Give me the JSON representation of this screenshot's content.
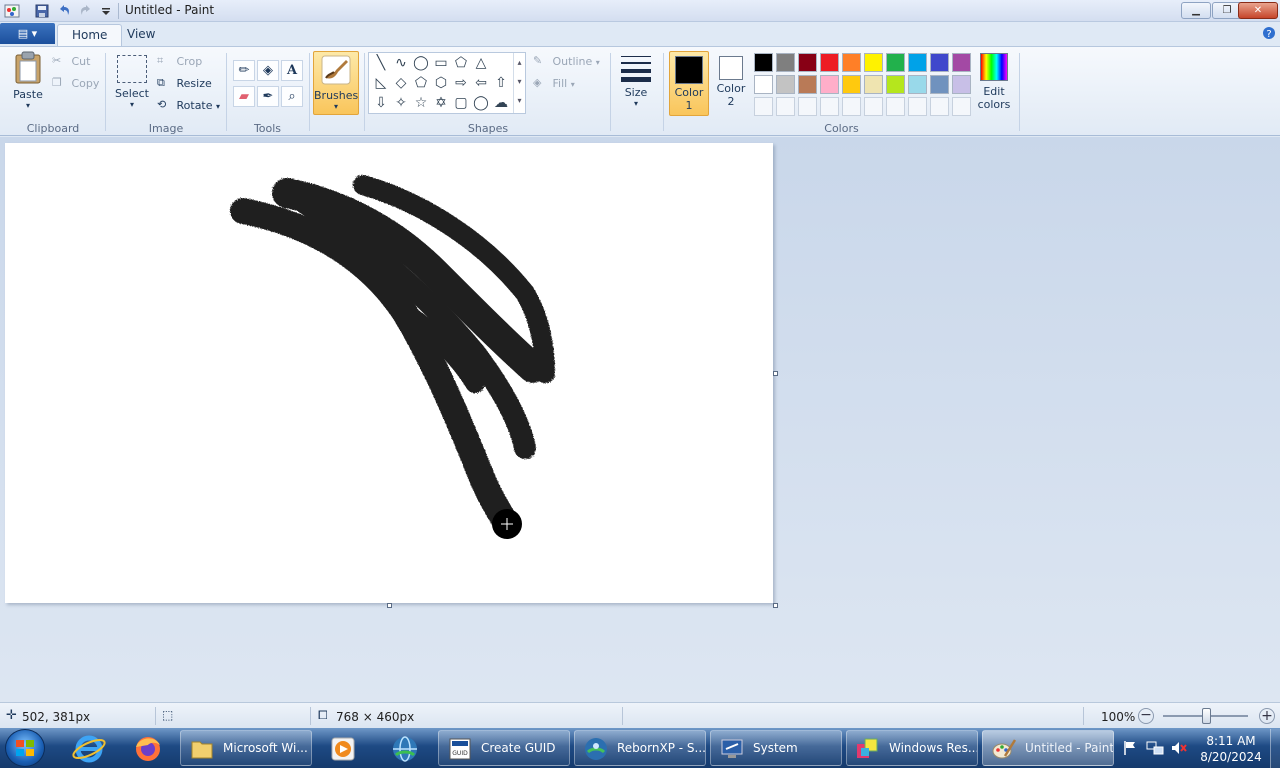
{
  "window": {
    "title": "Untitled - Paint",
    "minimize_label": "▁",
    "maximize_label": "❐",
    "close_label": "✕"
  },
  "ribbon": {
    "file_label": "▤ ▾",
    "tabs": [
      {
        "label": "Home"
      },
      {
        "label": "View"
      }
    ],
    "clipboard": {
      "paste": "Paste",
      "cut": "Cut",
      "copy": "Copy",
      "group": "Clipboard"
    },
    "image": {
      "select": "Select",
      "crop": "Crop",
      "resize": "Resize",
      "rotate": "Rotate",
      "group": "Image"
    },
    "tools": {
      "group": "Tools"
    },
    "brushes": {
      "label": "Brushes"
    },
    "shapes": {
      "outline": "Outline",
      "fill": "Fill",
      "group": "Shapes"
    },
    "size": {
      "label": "Size"
    },
    "colors": {
      "color1_line1": "Color",
      "color1_line2": "1",
      "color2_line1": "Color",
      "color2_line2": "2",
      "edit_line1": "Edit",
      "edit_line2": "colors",
      "group": "Colors",
      "color1_value": "#000000",
      "color2_value": "#ffffff",
      "palette_row1": [
        "#000000",
        "#7f7f7f",
        "#880015",
        "#ed1c24",
        "#ff7f27",
        "#fff200",
        "#22b14c",
        "#00a2e8",
        "#3f48cc",
        "#a349a4"
      ],
      "palette_row2": [
        "#ffffff",
        "#c3c3c3",
        "#b97a57",
        "#ffaec9",
        "#ffc90e",
        "#efe4b0",
        "#b5e61d",
        "#99d9ea",
        "#7092be",
        "#c8bfe7"
      ]
    }
  },
  "status": {
    "cursor_pos": "502, 381px",
    "canvas_size": "768 × 460px",
    "zoom": "100%"
  },
  "taskbar": {
    "buttons": [
      {
        "label": "Microsoft Wi..."
      },
      {
        "label": "Create GUID"
      },
      {
        "label": "RebornXP - S..."
      },
      {
        "label": "System"
      },
      {
        "label": "Windows Res..."
      },
      {
        "label": "Untitled - Paint"
      }
    ],
    "time": "8:11 AM",
    "date": "8/20/2024"
  }
}
